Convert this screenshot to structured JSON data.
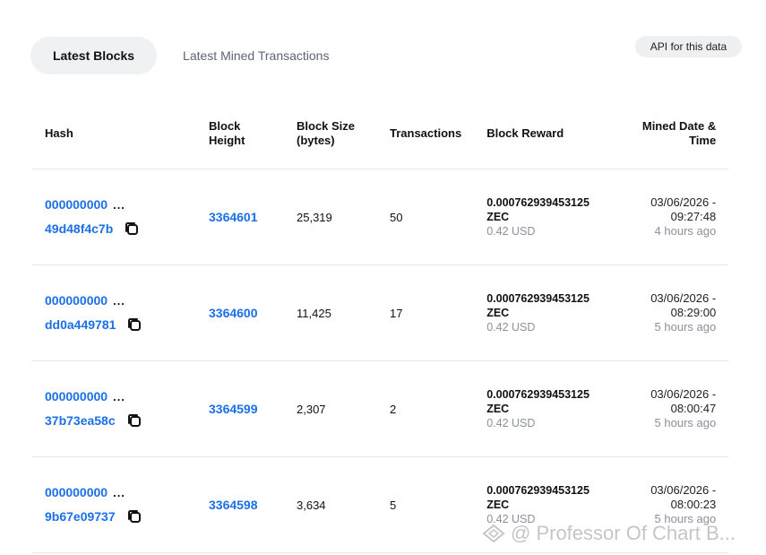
{
  "tabs": [
    {
      "label": "Latest Blocks",
      "active": true
    },
    {
      "label": "Latest Mined Transactions",
      "active": false
    }
  ],
  "api_button": "API for this data",
  "columns": {
    "hash": "Hash",
    "block_height": "Block Height",
    "block_size": "Block Size (bytes)",
    "transactions": "Transactions",
    "block_reward": "Block Reward",
    "mined_date": "Mined Date & Time"
  },
  "rows": [
    {
      "hash_prefix": "000000000",
      "ellipsis": "...",
      "hash_suffix": "49d48f4c7b",
      "height": "3364601",
      "size": "25,319",
      "transactions": "50",
      "reward_amount": "0.000762939453125",
      "reward_unit": "ZEC",
      "reward_usd": "0.42 USD",
      "date": "03/06/2026 -",
      "time": "09:27:48",
      "ago": "4 hours ago"
    },
    {
      "hash_prefix": "000000000",
      "ellipsis": "...",
      "hash_suffix": "dd0a449781",
      "height": "3364600",
      "size": "11,425",
      "transactions": "17",
      "reward_amount": "0.000762939453125",
      "reward_unit": "ZEC",
      "reward_usd": "0.42 USD",
      "date": "03/06/2026 -",
      "time": "08:29:00",
      "ago": "5 hours ago"
    },
    {
      "hash_prefix": "000000000",
      "ellipsis": "...",
      "hash_suffix": "37b73ea58c",
      "height": "3364599",
      "size": "2,307",
      "transactions": "2",
      "reward_amount": "0.000762939453125",
      "reward_unit": "ZEC",
      "reward_usd": "0.42 USD",
      "date": "03/06/2026 -",
      "time": "08:00:47",
      "ago": "5 hours ago"
    },
    {
      "hash_prefix": "000000000",
      "ellipsis": "...",
      "hash_suffix": "9b67e09737",
      "height": "3364598",
      "size": "3,634",
      "transactions": "5",
      "reward_amount": "0.000762939453125",
      "reward_unit": "ZEC",
      "reward_usd": "0.42 USD",
      "date": "03/06/2026 -",
      "time": "08:00:23",
      "ago": "5 hours ago"
    }
  ],
  "watermark": "@ Professor Of Chart B...",
  "colors": {
    "link": "#1b6fe8",
    "muted": "#8a909c",
    "tab_active_bg": "#f0f1f3"
  },
  "icons": {
    "copy": "copy-icon",
    "watermark": "diamond-logo-icon"
  }
}
